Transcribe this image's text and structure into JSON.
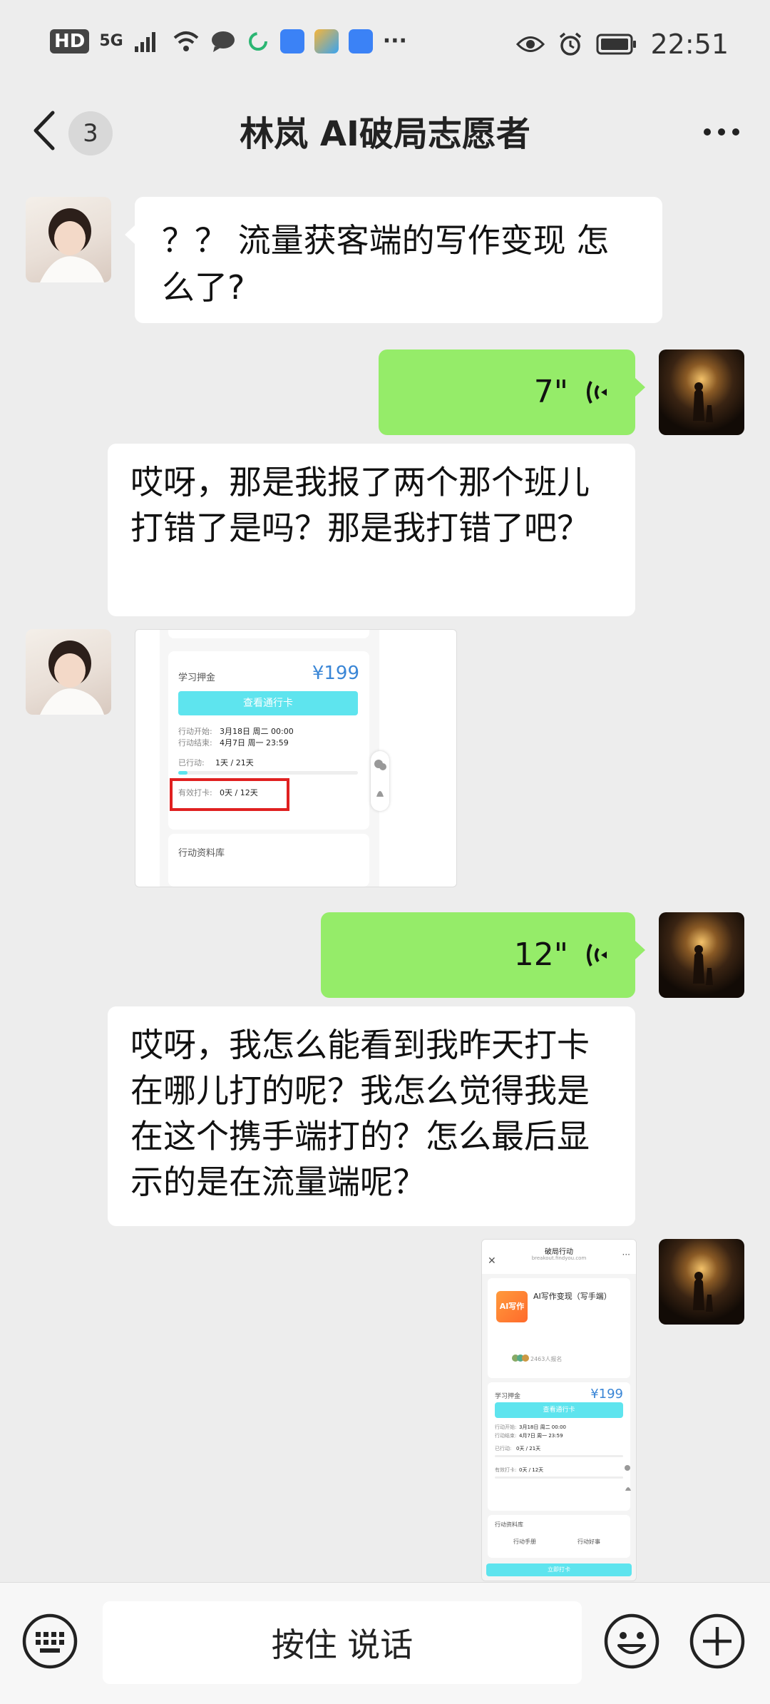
{
  "status_bar": {
    "network": "HD",
    "signal_label": "5G",
    "time": "22:51"
  },
  "header": {
    "unread_count": "3",
    "title": "林岚 AI破局志愿者"
  },
  "messages": {
    "m1_text": "？？ 流量获客端的写作变现 怎么了?",
    "m2_duration": "7\"",
    "m2_transcript": "哎呀，那是我报了两个那个班儿打错了是吗？那是我打错了吧？",
    "m4_duration": "12\"",
    "m4_transcript": "哎呀，我怎么能看到我昨天打卡在哪儿打的呢？我怎么觉得我是在这个携手端打的？怎么最后显示的是在流量端呢？"
  },
  "screenshot1": {
    "deposit_label": "学习押金",
    "price": "¥199",
    "card_button": "查看通行卡",
    "start_label": "行动开始:",
    "start_value": "3月18日 周二 00:00",
    "end_label": "行动结束:",
    "end_value": "4月7日 周一 23:59",
    "progress_label": "已行动:",
    "progress_value": "1天 / 21天",
    "checkin_label": "有效打卡:",
    "checkin_value": "0天 / 12天",
    "library_label": "行动资料库"
  },
  "screenshot2": {
    "page_title": "破局行动",
    "page_url": "breakout.findyou.com",
    "course_logo": "AI写作",
    "course_title": "AI写作变现（写手端）",
    "enrolled": "2463人报名",
    "deposit_label": "学习押金",
    "price": "¥199",
    "card_button": "查看通行卡",
    "start_label": "行动开始:",
    "start_value": "3月18日 周二 00:00",
    "end_label": "行动结束:",
    "end_value": "4月7日 周一 23:59",
    "progress_label": "已行动:",
    "progress_value": "0天 / 21天",
    "checkin_label": "有效打卡:",
    "checkin_value": "0天 / 12天",
    "library_label": "行动资料库",
    "manual": "行动手册",
    "good_things": "行动好事",
    "checkin_button": "立即打卡"
  },
  "bottom": {
    "hold_to_talk": "按住 说话"
  },
  "colors": {
    "chat_bg": "#ededed",
    "bubble_green": "#95ec69",
    "accent_cyan": "#5ee4ee",
    "highlight_red": "#e02020"
  }
}
